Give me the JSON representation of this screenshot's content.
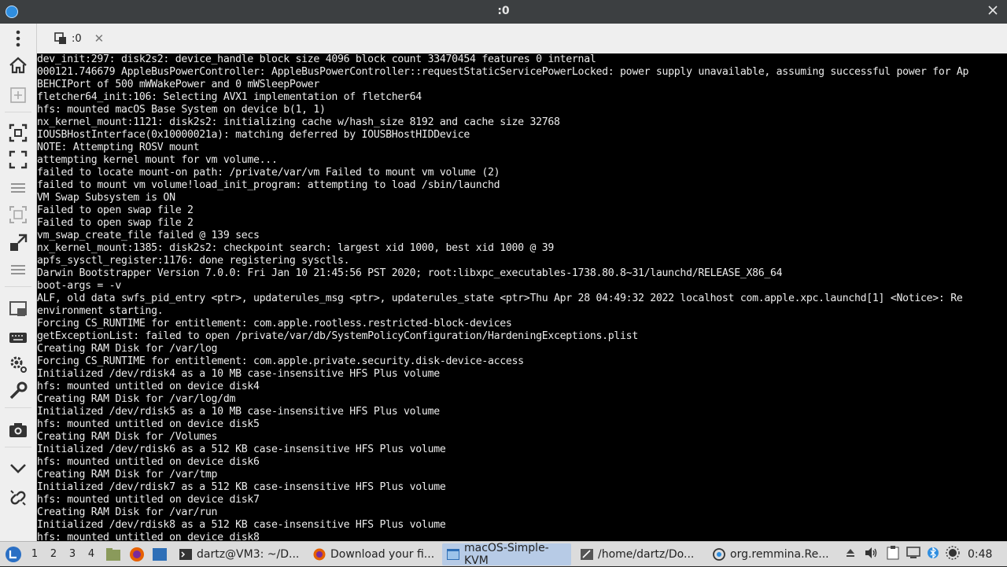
{
  "window": {
    "title": ":0",
    "tab_label": ":0"
  },
  "toolbar": {
    "items": [
      "menu-icon",
      "home-icon",
      "new-connection-icon",
      "fit-window-icon",
      "fullscreen-icon",
      "toggle-view-icon",
      "scale-icon",
      "dynamic-resize-icon",
      "multi-monitor-icon",
      "window-mode-icon",
      "keyboard-icon",
      "preferences-icon",
      "tools-icon",
      "screenshot-icon",
      "minimize-icon",
      "disconnect-icon"
    ]
  },
  "terminal": {
    "lines": [
      "dev_init:297: disk2s2: device_handle block size 4096 block count 33470454 features 0 internal",
      "000121.746679 AppleBusPowerController: AppleBusPowerController::requestStaticServicePowerLocked: power supply unavailable, assuming successful power for Ap",
      "BEHCIPort of 500 mWWakePower and 0 mWSleepPower",
      "fletcher64_init:106: Selecting AVX1 implementation of fletcher64",
      "hfs: mounted macOS Base System on device b(1, 1)",
      "nx_kernel_mount:1121: disk2s2: initializing cache w/hash_size 8192 and cache size 32768",
      "IOUSBHostInterface(0x10000021a): matching deferred by IOUSBHostHIDDevice",
      "NOTE: Attempting ROSV mount",
      "attempting kernel mount for vm volume...",
      "failed to locate mount-on path: /private/var/vm Failed to mount vm volume (2)",
      "failed to mount vm volume!load_init_program: attempting to load /sbin/launchd",
      "VM Swap Subsystem is ON",
      "Failed to open swap file 2",
      "Failed to open swap file 2",
      "vm_swap_create_file failed @ 139 secs",
      "nx_kernel_mount:1385: disk2s2: checkpoint search: largest xid 1000, best xid 1000 @ 39",
      "apfs_sysctl_register:1176: done registering sysctls.",
      "Darwin Bootstrapper Version 7.0.0: Fri Jan 10 21:45:56 PST 2020; root:libxpc_executables-1738.80.8~31/launchd/RELEASE_X86_64",
      "boot-args = -v",
      "ALF, old data swfs_pid_entry <ptr>, updaterules_msg <ptr>, updaterules_state <ptr>Thu Apr 28 04:49:32 2022 localhost com.apple.xpc.launchd[1] <Notice>: Re",
      "environment starting.",
      "Forcing CS_RUNTIME for entitlement: com.apple.rootless.restricted-block-devices",
      "getExceptionList: failed to open /private/var/db/SystemPolicyConfiguration/HardeningExceptions.plist",
      "Creating RAM Disk for /var/log",
      "Forcing CS_RUNTIME for entitlement: com.apple.private.security.disk-device-access",
      "Initialized /dev/rdisk4 as a 10 MB case-insensitive HFS Plus volume",
      "hfs: mounted untitled on device disk4",
      "Creating RAM Disk for /var/log/dm",
      "Initialized /dev/rdisk5 as a 10 MB case-insensitive HFS Plus volume",
      "hfs: mounted untitled on device disk5",
      "Creating RAM Disk for /Volumes",
      "Initialized /dev/rdisk6 as a 512 KB case-insensitive HFS Plus volume",
      "hfs: mounted untitled on device disk6",
      "Creating RAM Disk for /var/tmp",
      "Initialized /dev/rdisk7 as a 512 KB case-insensitive HFS Plus volume",
      "hfs: mounted untitled on device disk7",
      "Creating RAM Disk for /var/run",
      "Initialized /dev/rdisk8 as a 512 KB case-insensitive HFS Plus volume",
      "hfs: mounted untitled on device disk8"
    ]
  },
  "taskbar": {
    "workspaces": [
      "1",
      "2",
      "3",
      "4"
    ],
    "tasks": [
      {
        "label": "dartz@VM3: ~/D...",
        "icon": "terminal-icon"
      },
      {
        "label": "Download your fi...",
        "icon": "firefox-icon"
      },
      {
        "label": "macOS-Simple-KVM",
        "icon": "window-icon"
      },
      {
        "label": "/home/dartz/Do...",
        "icon": "editor-icon"
      },
      {
        "label": "org.remmina.Re...",
        "icon": "remmina-icon"
      }
    ],
    "clock": "0:48"
  },
  "colors": {
    "accent": "#3daee9",
    "titlebar": "#3c3f41",
    "terminal_bg": "#000000",
    "terminal_fg": "#ececec",
    "taskbar": "#dcdcdc"
  }
}
